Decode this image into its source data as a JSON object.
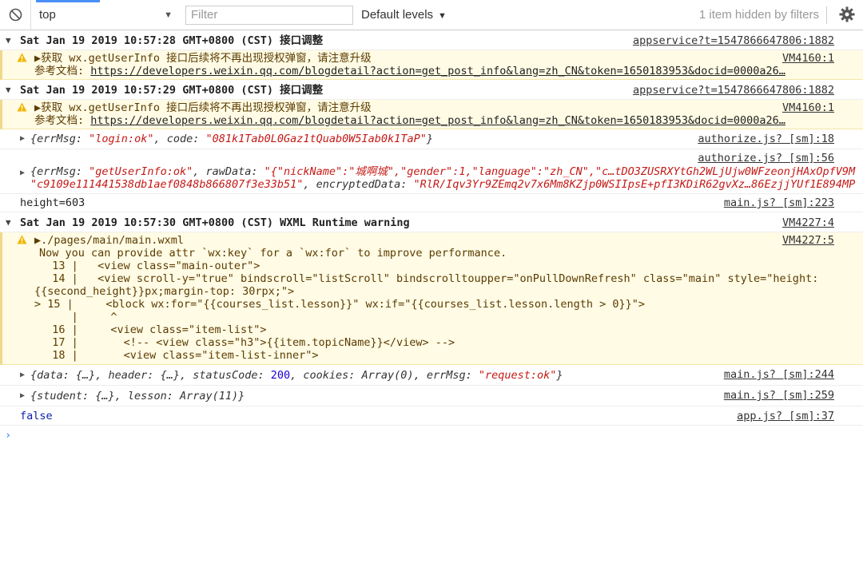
{
  "toolbar": {
    "context": "top",
    "filter_placeholder": "Filter",
    "levels": "Default levels",
    "hidden": "1 item hidden by filters"
  },
  "logs": {
    "g1": {
      "title": "Sat Jan 19 2019 10:57:28 GMT+0800 (CST) 接口调整",
      "src": "appservice?t=1547866647806:1882"
    },
    "w1": {
      "line1": "获取 wx.getUserInfo 接口后续将不再出现授权弹窗，请注意升级",
      "label": "参考文档: ",
      "url": "https://developers.weixin.qq.com/blogdetail?action=get_post_info&lang=zh_CN&token=1650183953&docid=0000a26…",
      "src": "VM4160:1"
    },
    "g2": {
      "title": "Sat Jan 19 2019 10:57:29 GMT+0800 (CST) 接口调整",
      "src": "appservice?t=1547866647806:1882"
    },
    "w2": {
      "line1": "获取 wx.getUserInfo 接口后续将不再出现授权弹窗，请注意升级",
      "label": "参考文档: ",
      "url": "https://developers.weixin.qq.com/blogdetail?action=get_post_info&lang=zh_CN&token=1650183953&docid=0000a26…",
      "src": "VM4160:1"
    },
    "o1": {
      "k1": "errMsg: ",
      "v1": "\"login:ok\"",
      "k2": ", code: ",
      "v2": "\"081k1Tab0L0Gaz1tQuab0W5Iab0k1TaP\"",
      "end": "}",
      "src": "authorize.js? [sm]:18"
    },
    "o2": {
      "src": "authorize.js? [sm]:56",
      "k1": "errMsg: ",
      "v1": "\"getUserInfo:ok\"",
      "k2": ", rawData: ",
      "v2": "\"{\"nickName\":\"城啊城\",\"gender\":1,\"language\":\"zh_CN\",\"c…tDO3ZUSRXYtGh2WLjUjw0WFzeonjHAxOpfV9M",
      "v3": "\"c9109e111441538db1aef0848b866807f3e33b51\"",
      "k3": ", encryptedData: ",
      "v4": "\"RlR/Iqv3Yr9ZEmq2v7x6Mm8KZjp0WSIIpsE+pfI3KDiR62gvXz…86EzjjYUf1E894MP"
    },
    "h": {
      "text": "height=603",
      "src": "main.js? [sm]:223"
    },
    "g3": {
      "title": "Sat Jan 19 2019 10:57:30 GMT+0800 (CST) WXML Runtime warning",
      "src": "VM4227:4"
    },
    "w3": {
      "path": "./pages/main/main.wxml",
      "src": "VM4227:5",
      "lines": [
        "Now you can provide attr `wx:key` for a `wx:for` to improve performance.",
        "  13 |   <view class=\"main-outer\">",
        "  14 |   <view scroll-y=\"true\" bindscroll=\"listScroll\" bindscrolltoupper=\"onPullDownRefresh\" class=\"main\" style=\"height:",
        "{{second_height}}px;margin-top: 30rpx;\">",
        "> 15 |     <block wx:for=\"{{courses_list.lesson}}\" wx:if=\"{{courses_list.lesson.length > 0}}\">",
        "     |     ^",
        "  16 |     <view class=\"item-list\">",
        "  17 |       <!-- <view class=\"h3\">{{item.topicName}}</view> -->",
        "  18 |       <view class=\"item-list-inner\">"
      ]
    },
    "o3": {
      "a": "data: {…}, header: {…}, statusCode: ",
      "n": "200",
      "b": ", cookies: Array(0), errMsg: ",
      "s": "\"request:ok\"",
      "end": "}",
      "src": "main.js? [sm]:244"
    },
    "o4": {
      "text": "student: {…}, lesson: Array(11)}",
      "src": "main.js? [sm]:259"
    },
    "f": {
      "text": "false",
      "src": "app.js? [sm]:37"
    }
  },
  "colors": {
    "accent": "#4a8ff7",
    "warn_bg": "#fffbe5",
    "string": "#c41a16",
    "number": "#1c00cf"
  }
}
